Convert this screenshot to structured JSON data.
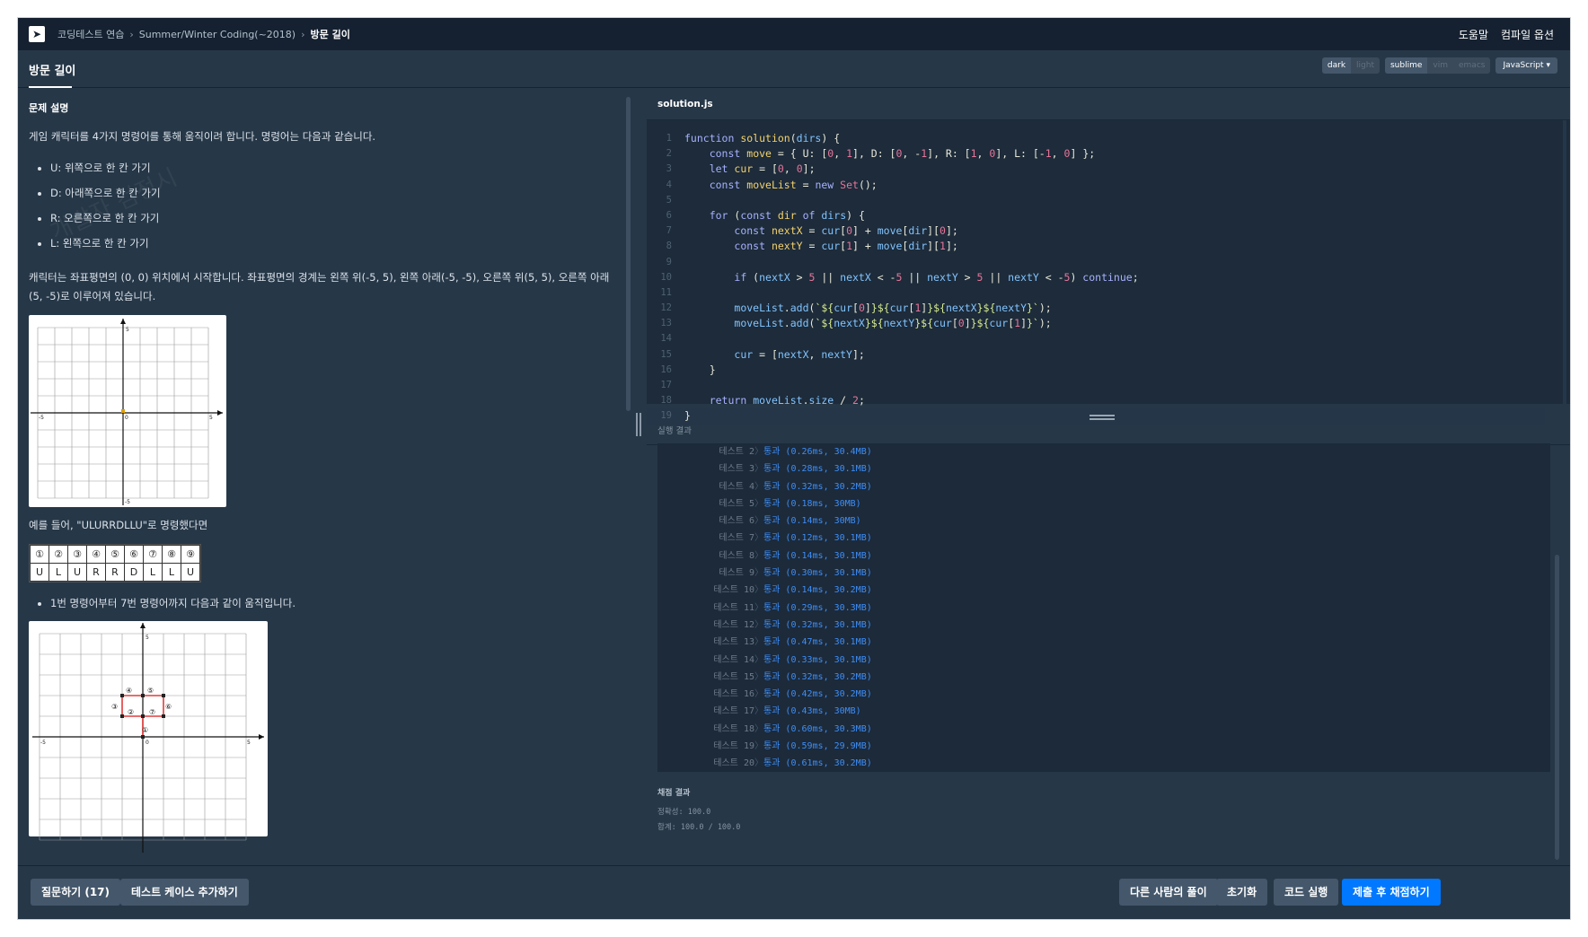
{
  "topbar": {
    "breadcrumbs": [
      "코딩테스트 연습",
      "Summer/Winter Coding(~2018)",
      "방문 길이"
    ],
    "links": [
      "도움말",
      "컴파일 옵션"
    ]
  },
  "header": {
    "title": "방문 길이",
    "theme_options": [
      "dark",
      "light"
    ],
    "keymap_options": [
      "sublime",
      "vim",
      "emacs"
    ],
    "language": "JavaScript"
  },
  "problem": {
    "section_title": "문제 설명",
    "intro": "게임 캐릭터를 4가지 명령어를 통해 움직이려 합니다. 명령어는 다음과 같습니다.",
    "commands": [
      "U: 위쪽으로 한 칸 가기",
      "D: 아래쪽으로 한 칸 가기",
      "R: 오른쪽으로 한 칸 가기",
      "L: 왼쪽으로 한 칸 가기"
    ],
    "desc2": "캐릭터는 좌표평면의 (0, 0) 위치에서 시작합니다. 좌표평면의 경계는 왼쪽 위(-5, 5), 왼쪽 아래(-5, -5), 오른쪽 위(5, 5), 오른쪽 아래(5, -5)로 이루어져 있습니다.",
    "example_intro": "예를 들어, \"ULURRDLLU\"로 명령했다면",
    "cmd_numbers": [
      "①",
      "②",
      "③",
      "④",
      "⑤",
      "⑥",
      "⑦",
      "⑧",
      "⑨"
    ],
    "cmd_letters": [
      "U",
      "L",
      "U",
      "R",
      "R",
      "D",
      "L",
      "L",
      "U"
    ],
    "bullet2": "1번 명령어부터 7번 명령어까지 다음과 같이 움직입니다.",
    "axis_labels": {
      "five": "5",
      "neg_five": "-5",
      "zero": "0"
    },
    "watermark": "개발자 검정시"
  },
  "editor": {
    "filename": "solution.js",
    "line_numbers": [
      "1",
      "2",
      "3",
      "4",
      "5",
      "6",
      "7",
      "8",
      "9",
      "10",
      "11",
      "12",
      "13",
      "14",
      "15",
      "16",
      "17",
      "18",
      "19"
    ]
  },
  "results": {
    "label": "실행 결과",
    "rows": [
      {
        "name": "테스트 2",
        "value": "통과 (0.26ms, 30.4MB)"
      },
      {
        "name": "테스트 3",
        "value": "통과 (0.28ms, 30.1MB)"
      },
      {
        "name": "테스트 4",
        "value": "통과 (0.32ms, 30.2MB)"
      },
      {
        "name": "테스트 5",
        "value": "통과 (0.18ms, 30MB)"
      },
      {
        "name": "테스트 6",
        "value": "통과 (0.14ms, 30MB)"
      },
      {
        "name": "테스트 7",
        "value": "통과 (0.12ms, 30.1MB)"
      },
      {
        "name": "테스트 8",
        "value": "통과 (0.14ms, 30.1MB)"
      },
      {
        "name": "테스트 9",
        "value": "통과 (0.30ms, 30.1MB)"
      },
      {
        "name": "테스트 10",
        "value": "통과 (0.14ms, 30.2MB)"
      },
      {
        "name": "테스트 11",
        "value": "통과 (0.29ms, 30.3MB)"
      },
      {
        "name": "테스트 12",
        "value": "통과 (0.32ms, 30.1MB)"
      },
      {
        "name": "테스트 13",
        "value": "통과 (0.47ms, 30.1MB)"
      },
      {
        "name": "테스트 14",
        "value": "통과 (0.33ms, 30.1MB)"
      },
      {
        "name": "테스트 15",
        "value": "통과 (0.32ms, 30.2MB)"
      },
      {
        "name": "테스트 16",
        "value": "통과 (0.42ms, 30.2MB)"
      },
      {
        "name": "테스트 17",
        "value": "통과 (0.43ms, 30MB)"
      },
      {
        "name": "테스트 18",
        "value": "통과 (0.60ms, 30.3MB)"
      },
      {
        "name": "테스트 19",
        "value": "통과 (0.59ms, 29.9MB)"
      },
      {
        "name": "테스트 20",
        "value": "통과 (0.61ms, 30.2MB)"
      }
    ],
    "grade_title": "채점 결과",
    "accuracy": "정확성: 100.0",
    "total": "합계: 100.0 / 100.0"
  },
  "bottom": {
    "question_button": "질문하기 (17)",
    "add_testcase_button": "테스트 케이스 추가하기",
    "others_solution_button": "다른 사람의 풀이",
    "reset_button": "초기화",
    "run_button": "코드 실행",
    "submit_button": "제출 후 채점하기"
  },
  "colors": {
    "accent": "#0078ff",
    "background": "#263747",
    "topbar": "#152130",
    "pass": "#3e8ef7"
  }
}
